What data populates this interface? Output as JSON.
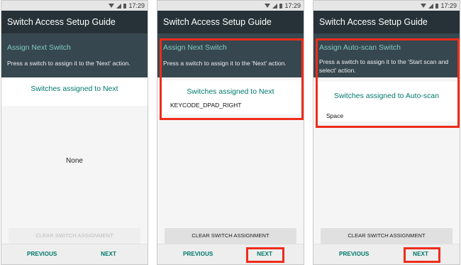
{
  "colors": {
    "appbar": "#263238",
    "panel": "#37474f",
    "teal": "#00796b",
    "highlight": "#ee2c1b"
  },
  "status": {
    "time": "17:29",
    "icons": [
      "wifi-icon",
      "signal-icon",
      "battery-icon"
    ]
  },
  "screens": [
    {
      "app_title": "Switch Access Setup Guide",
      "assign_title": "Assign Next Switch",
      "assign_desc": "Press a switch to assign it to the 'Next' action.",
      "switches_heading": "Switches assigned to Next",
      "assigned_value": "None",
      "clear_label": "CLEAR SWITCH ASSIGNMENT",
      "clear_enabled": false,
      "prev_label": "PREVIOUS",
      "next_label": "NEXT"
    },
    {
      "app_title": "Switch Access Setup Guide",
      "assign_title": "Assign Next Switch",
      "assign_desc": "Press a switch to assign it to the 'Next' action.",
      "switches_heading": "Switches assigned to Next",
      "assigned_value": "KEYCODE_DPAD_RIGHT",
      "clear_label": "CLEAR SWITCH ASSIGNMENT",
      "clear_enabled": true,
      "prev_label": "PREVIOUS",
      "next_label": "NEXT"
    },
    {
      "app_title": "Switch Access Setup Guide",
      "assign_title": "Assign Auto-scan Switch",
      "assign_desc": "Press a switch to assign it to the 'Start scan and select' action.",
      "switches_heading": "Switches assigned to Auto-scan",
      "assigned_value": "Space",
      "clear_label": "CLEAR SWITCH ASSIGNMENT",
      "clear_enabled": true,
      "prev_label": "PREVIOUS",
      "next_label": "NEXT"
    }
  ]
}
